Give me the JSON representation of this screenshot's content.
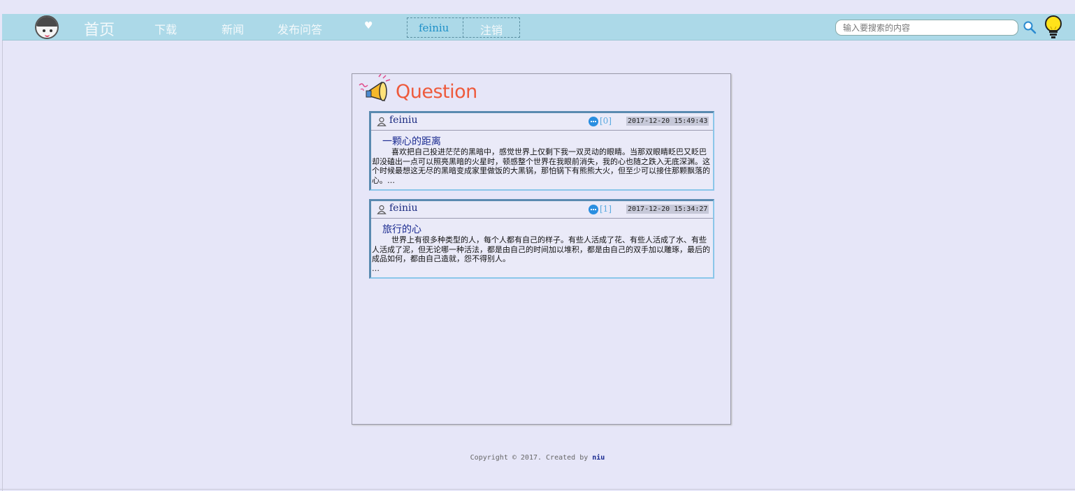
{
  "nav": {
    "home": "首页",
    "download": "下载",
    "news": "新闻",
    "ask": "发布问答",
    "heart": "♥",
    "username": "feiniu",
    "logout": "注销",
    "search_placeholder": "输入要搜索的内容"
  },
  "panel": {
    "title": "Question",
    "questions": [
      {
        "user": "feiniu",
        "comments": "[0]",
        "time": "2017-12-20 15:49:43",
        "title": "一颗心的距离",
        "body": "喜欢把自己投进茫茫的黑暗中，感觉世界上仅剩下我一双灵动的眼睛。当那双眼睛眨巴又眨巴却没磕出一点可以照亮黑暗的火星时，顿感整个世界在我眼前消失，我的心也随之跌入无底深渊。这个时候最想这无尽的黑暗变成家里做饭的大黑锅，那怕锅下有熊熊大火，但至少可以接住那颗飘落的心。…"
      },
      {
        "user": "feiniu",
        "comments": "[1]",
        "time": "2017-12-20 15:34:27",
        "title": "旅行的心",
        "body": "世界上有很多种类型的人，每个人都有自己的样子。有些人活成了花、有些人活成了水、有些人活成了泥，但无论哪一种活法，都是由自己的时间加以堆积，都是由自己的双手加以雕琢，最后的成品如何，都由自己造就，怨不得别人。\n…"
      }
    ]
  },
  "footer": {
    "copyright": "Copyright © 2017. Created by ",
    "author": "niu"
  },
  "colors": {
    "navbar": "#acd9e8",
    "background": "#e6e6f8",
    "title": "#ee5a3c",
    "link": "#1a2a90"
  }
}
